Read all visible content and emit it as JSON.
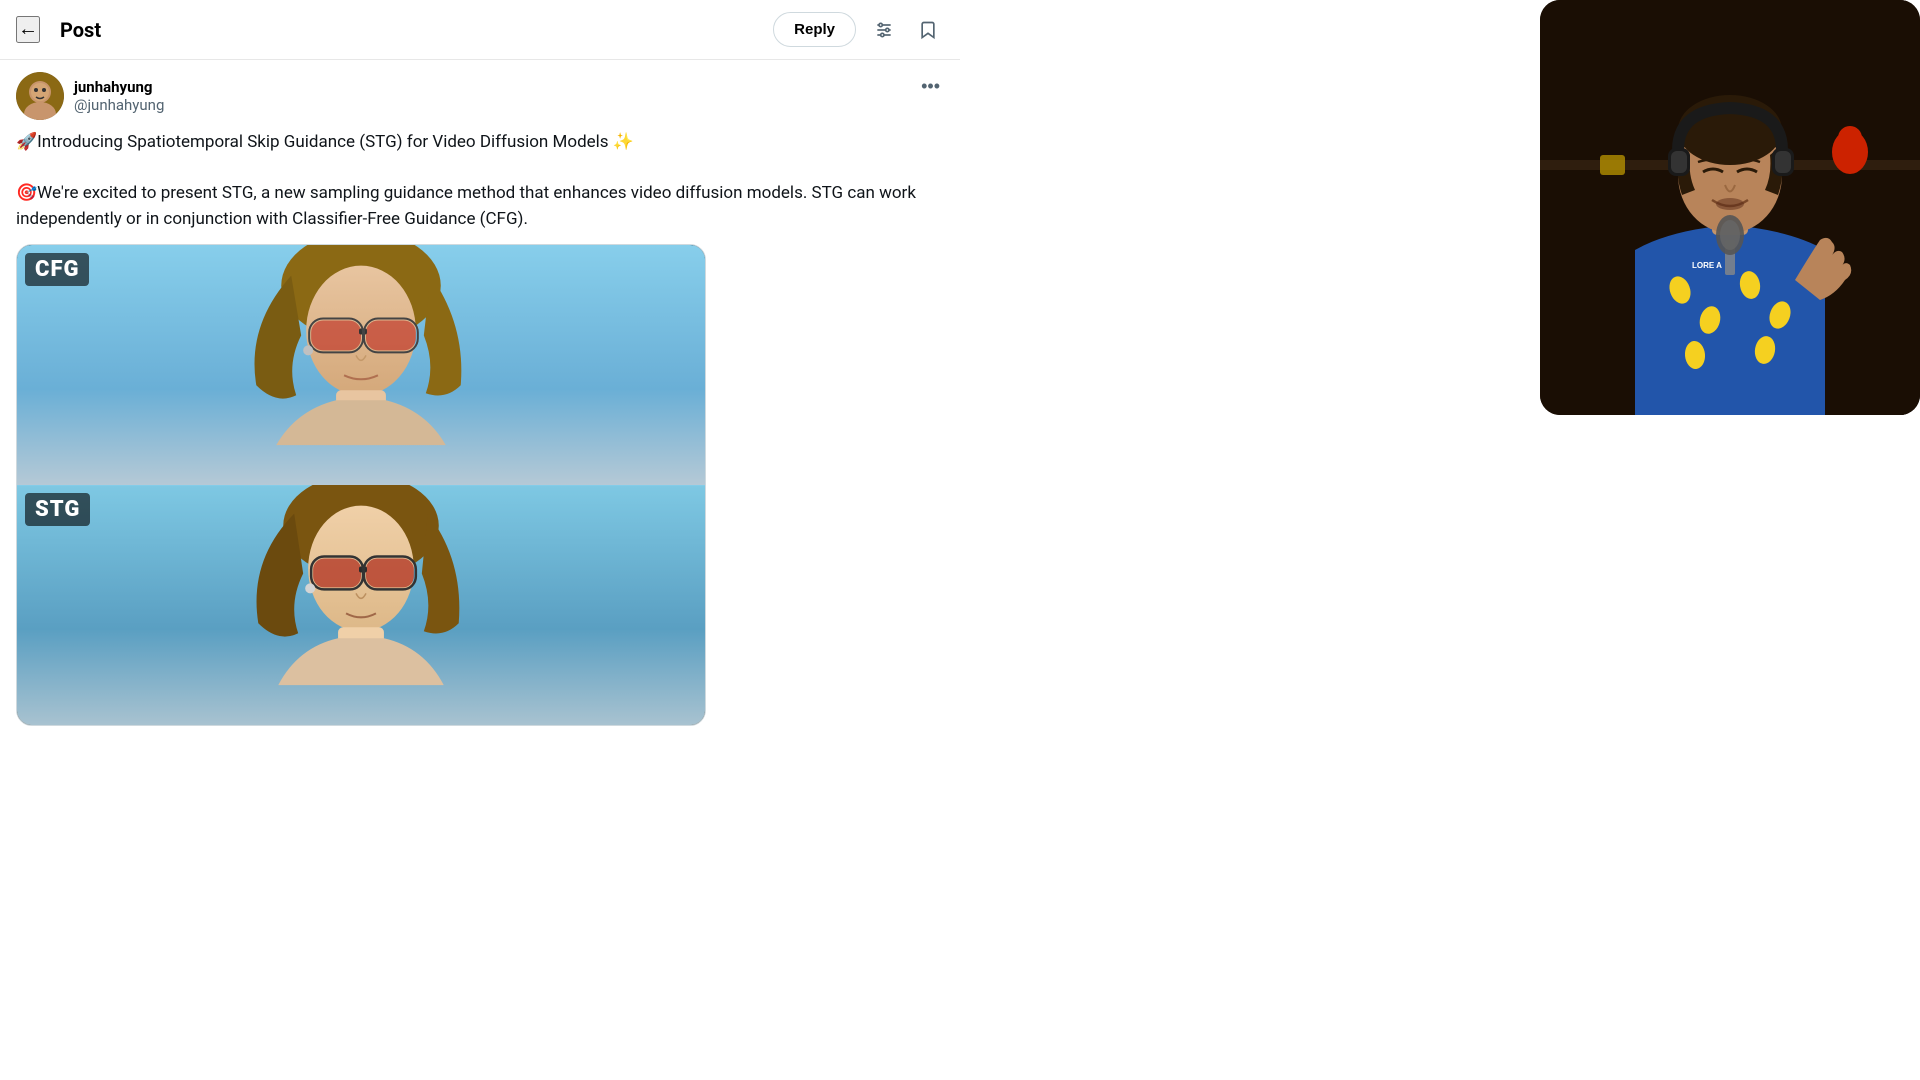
{
  "header": {
    "title": "Post",
    "back_label": "←",
    "reply_label": "Reply",
    "adjust_icon": "⇅",
    "bookmark_icon": "📖"
  },
  "post": {
    "username": "junhahyung",
    "handle": "@junhahyung",
    "more_icon": "•••",
    "text_line1": "🚀Introducing Spatiotemporal Skip Guidance (STG) for Video Diffusion Models ✨",
    "text_line2": "🎯We're excited to present STG, a new sampling guidance method that enhances video diffusion models. STG can work independently or in conjunction with Classifier-Free Guidance (CFG).",
    "image": {
      "cfg_label": "CFG",
      "stg_label": "STG"
    }
  }
}
